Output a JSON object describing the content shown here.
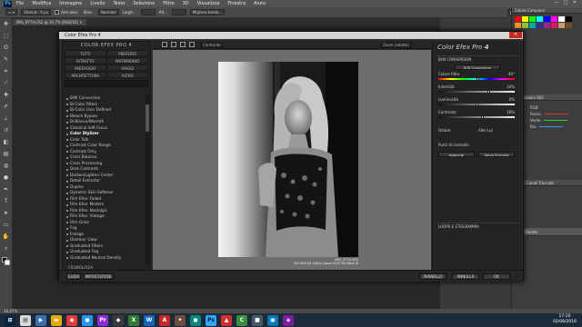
{
  "ps": {
    "logo": "Ps",
    "menu": [
      "File",
      "Modifica",
      "Immagine",
      "Livello",
      "Testo",
      "Selezione",
      "Filtro",
      "3D",
      "Visualizza",
      "Finestra",
      "Aiuto"
    ],
    "win_controls": [
      "—",
      "□",
      "✕"
    ],
    "options": {
      "preset": "Sfumat.: 0 px",
      "antialias_label": "Anti-alias",
      "style_label": "Stile:",
      "style_value": "Normale",
      "width_label": "Largh.:",
      "height_label": "Alt.:",
      "refine_button": "Migliora bordo...",
      "workspace": "Essentials"
    },
    "document_tab": "IMG_9774.CR2 @ 16,7% (RGB/16) ✕",
    "status": "16,67%",
    "panels": {
      "tab1": "Colore    Campioni",
      "tab2": "Regolazioni    Stili",
      "tab3": "Livelli   Canali   Tracciati",
      "channels": [
        "RGB",
        "Rosso",
        "Verde",
        "Blu"
      ],
      "layers": [
        "Sfondo"
      ],
      "swatch_colors": [
        "#ff0000",
        "#ffff00",
        "#00ff00",
        "#00ffff",
        "#0000ff",
        "#ff00ff",
        "#ffffff",
        "#000000",
        "#f7941d",
        "#8dc63f",
        "#00a99d",
        "#2e3192",
        "#92278f",
        "#ed145b",
        "#c69c6d",
        "#754c24"
      ]
    }
  },
  "cefx": {
    "title": "Color Efex Pro 4",
    "brand": "COLOR EFEX PRO 4",
    "categories": [
      "TUTTI",
      "PREFERITI",
      "RITRATTO",
      "MATRIMONIO",
      "PAESAGGIO",
      "VIAGGI",
      "ARCHITETTURA",
      "ALTRO"
    ],
    "filters": [
      "B/W Conversion",
      "Bi-Color Filters",
      "Bi-Color User Defined",
      "Bleach Bypass",
      "Brilliance/Warmth",
      "Classical Soft Focus",
      "Color Stylizer",
      "Color Talk",
      "Contrast Color Range",
      "Contrast Only",
      "Cross Balance",
      "Cross Processing",
      "Dark Contrasts",
      "Darken/Lighten Center",
      "Detail Extractor",
      "Duplex",
      "Dynamic Skin Softener",
      "Film Efex: Faded",
      "Film Efex: Modern",
      "Film Efex: Nostalgic",
      "Film Efex: Vintage",
      "Film Grain",
      "Fog",
      "Foliage",
      "Glamour Glow",
      "Graduated Filters",
      "Graduated Fog",
      "Graduated Neutral Density"
    ],
    "active_filter": "Color Stylizer",
    "tooltip": "Color Stylizer",
    "history_label": "CRONOLOGIA",
    "bottom_buttons": {
      "help": "GUIDA",
      "settings": "IMPOSTAZIONI",
      "brush": "PENNELLO",
      "cancel": "ANNULLA",
      "ok": "OK"
    },
    "toolbar": {
      "view_label": "Confronto",
      "zoom_label": "Zoom (adatta)"
    },
    "caption_line1": "IMG_9774.CR2",
    "caption_line2": "ISO 800   f/4   1/60s   Canon EOS 5D Mark III",
    "right": {
      "title": "Color Efex Pro",
      "title_num": "4",
      "section": "B/W CONVERSION",
      "method": "B/W Conversion",
      "sliders": [
        {
          "label": "Colore filtro",
          "value": "40°",
          "pos": 0.52
        },
        {
          "label": "Intensità",
          "value": "34%",
          "pos": 0.66
        },
        {
          "label": "Luminosità",
          "value": "0%",
          "pos": 0.5
        },
        {
          "label": "Contrasto",
          "value": "18%",
          "pos": 0.58
        }
      ],
      "shadows_label": "Ombre",
      "highlights_label": "Alte luci",
      "control_points": "Punti di controllo",
      "add_filter_button": "Aggiungi",
      "save_preset_button": "Salva Formula",
      "footer": "LOOPS E STOGRAMMA"
    }
  },
  "taskbar": {
    "time": "17:20",
    "date": "02/08/2016"
  }
}
